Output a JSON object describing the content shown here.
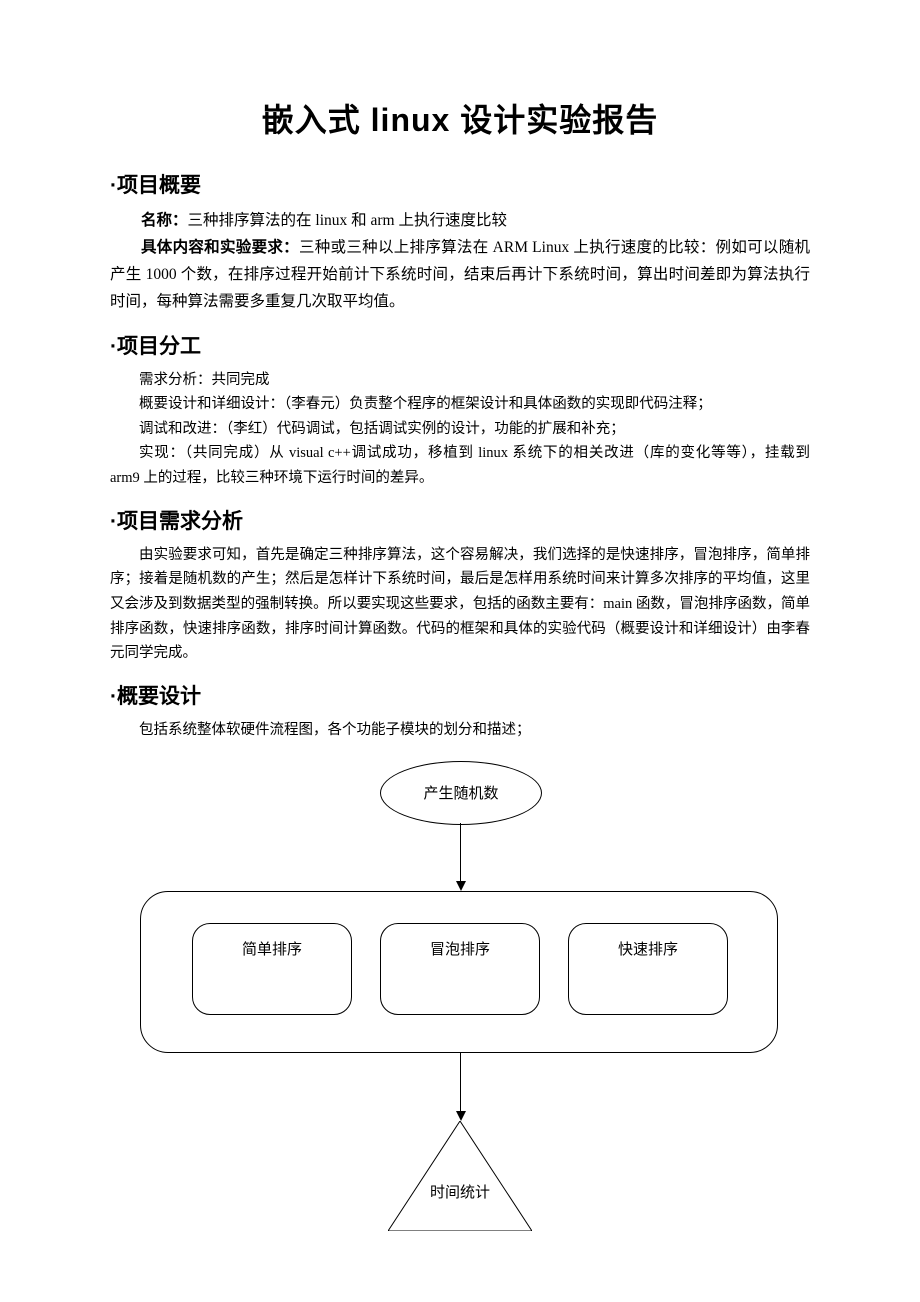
{
  "title": "嵌入式 linux 设计实验报告",
  "sections": {
    "overview": {
      "heading": "·项目概要",
      "name_label": "名称：",
      "name_text": "三种排序算法的在 linux 和 arm 上执行速度比较",
      "content_label": "具体内容和实验要求：",
      "content_text": "三种或三种以上排序算法在 ARM Linux 上执行速度的比较：例如可以随机产生 1000 个数，在排序过程开始前计下系统时间，结束后再计下系统时间，算出时间差即为算法执行时间，每种算法需要多重复几次取平均值。"
    },
    "division": {
      "heading": "·项目分工",
      "lines": [
        "需求分析：共同完成",
        "概要设计和详细设计：（李春元）负责整个程序的框架设计和具体函数的实现即代码注释；",
        "调试和改进：（李红）代码调试，包括调试实例的设计，功能的扩展和补充；",
        "实现：（共同完成）从 visual c++调试成功，移植到 linux 系统下的相关改进（库的变化等等），挂载到 arm9 上的过程，比较三种环境下运行时间的差异。"
      ]
    },
    "requirements": {
      "heading": "·项目需求分析",
      "text": "由实验要求可知，首先是确定三种排序算法，这个容易解决，我们选择的是快速排序，冒泡排序，简单排序；接着是随机数的产生；然后是怎样计下系统时间，最后是怎样用系统时间来计算多次排序的平均值，这里又会涉及到数据类型的强制转换。所以要实现这些要求，包括的函数主要有：main 函数，冒泡排序函数，简单排序函数，快速排序函数，排序时间计算函数。代码的框架和具体的实验代码（概要设计和详细设计）由李春元同学完成。"
    },
    "design": {
      "heading": "·概要设计",
      "text": "包括系统整体软硬件流程图，各个功能子模块的划分和描述；"
    }
  },
  "diagram": {
    "node_random": "产生随机数",
    "node_simple": "简单排序",
    "node_bubble": "冒泡排序",
    "node_quick": "快速排序",
    "node_time": "时间统计"
  }
}
